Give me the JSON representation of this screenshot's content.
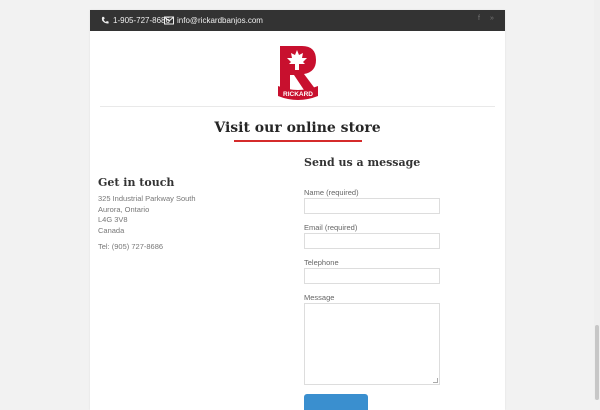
{
  "topbar": {
    "phone": "1-905-727-8686",
    "email": "info@rickardbanjos.com",
    "phone_icon": "phone-icon",
    "email_icon": "envelope-icon",
    "social_1": "f",
    "social_2": "»"
  },
  "logo": {
    "text": "RICKARD",
    "brand_color": "#c8102e"
  },
  "store_link": "Visit our online store",
  "contact": {
    "heading": "Get in touch",
    "address": [
      "325 Industrial Parkway South",
      "Aurora, Ontario",
      "L4G 3V8",
      "Canada"
    ],
    "tel": "Tel: (905) 727-8686"
  },
  "form": {
    "heading": "Send us a message",
    "name_label": "Name (required)",
    "email_label": "Email (required)",
    "phone_label": "Telephone",
    "message_label": "Message",
    "name_value": "",
    "email_value": "",
    "phone_value": "",
    "message_value": "",
    "submit_label": "",
    "submit_color": "#3a8fcf"
  },
  "colors": {
    "accent": "#d52b2b",
    "topbar": "#333333"
  }
}
